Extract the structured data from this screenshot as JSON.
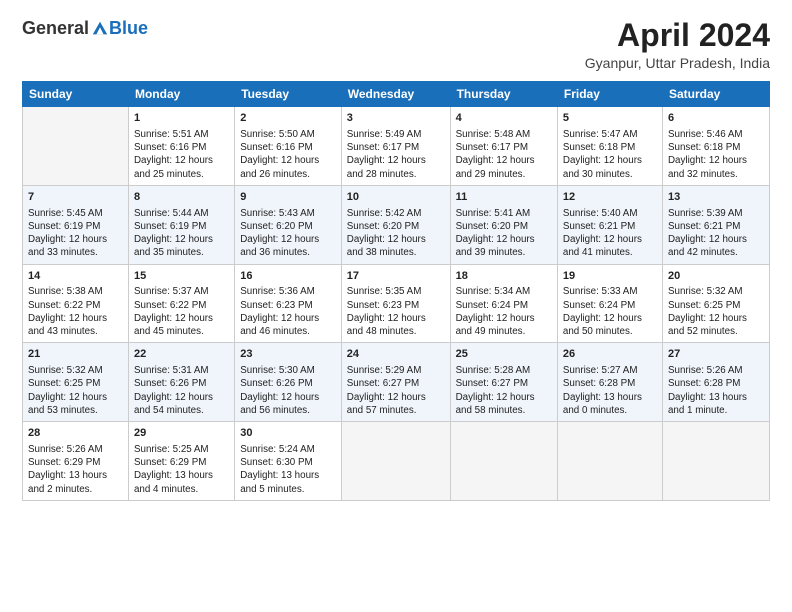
{
  "header": {
    "logo_general": "General",
    "logo_blue": "Blue",
    "title": "April 2024",
    "subtitle": "Gyanpur, Uttar Pradesh, India"
  },
  "days_of_week": [
    "Sunday",
    "Monday",
    "Tuesday",
    "Wednesday",
    "Thursday",
    "Friday",
    "Saturday"
  ],
  "weeks": [
    [
      {
        "day": "",
        "sunrise": "",
        "sunset": "",
        "daylight": "",
        "empty": true
      },
      {
        "day": "1",
        "sunrise": "Sunrise: 5:51 AM",
        "sunset": "Sunset: 6:16 PM",
        "daylight": "Daylight: 12 hours and 25 minutes."
      },
      {
        "day": "2",
        "sunrise": "Sunrise: 5:50 AM",
        "sunset": "Sunset: 6:16 PM",
        "daylight": "Daylight: 12 hours and 26 minutes."
      },
      {
        "day": "3",
        "sunrise": "Sunrise: 5:49 AM",
        "sunset": "Sunset: 6:17 PM",
        "daylight": "Daylight: 12 hours and 28 minutes."
      },
      {
        "day": "4",
        "sunrise": "Sunrise: 5:48 AM",
        "sunset": "Sunset: 6:17 PM",
        "daylight": "Daylight: 12 hours and 29 minutes."
      },
      {
        "day": "5",
        "sunrise": "Sunrise: 5:47 AM",
        "sunset": "Sunset: 6:18 PM",
        "daylight": "Daylight: 12 hours and 30 minutes."
      },
      {
        "day": "6",
        "sunrise": "Sunrise: 5:46 AM",
        "sunset": "Sunset: 6:18 PM",
        "daylight": "Daylight: 12 hours and 32 minutes."
      }
    ],
    [
      {
        "day": "7",
        "sunrise": "Sunrise: 5:45 AM",
        "sunset": "Sunset: 6:19 PM",
        "daylight": "Daylight: 12 hours and 33 minutes."
      },
      {
        "day": "8",
        "sunrise": "Sunrise: 5:44 AM",
        "sunset": "Sunset: 6:19 PM",
        "daylight": "Daylight: 12 hours and 35 minutes."
      },
      {
        "day": "9",
        "sunrise": "Sunrise: 5:43 AM",
        "sunset": "Sunset: 6:20 PM",
        "daylight": "Daylight: 12 hours and 36 minutes."
      },
      {
        "day": "10",
        "sunrise": "Sunrise: 5:42 AM",
        "sunset": "Sunset: 6:20 PM",
        "daylight": "Daylight: 12 hours and 38 minutes."
      },
      {
        "day": "11",
        "sunrise": "Sunrise: 5:41 AM",
        "sunset": "Sunset: 6:20 PM",
        "daylight": "Daylight: 12 hours and 39 minutes."
      },
      {
        "day": "12",
        "sunrise": "Sunrise: 5:40 AM",
        "sunset": "Sunset: 6:21 PM",
        "daylight": "Daylight: 12 hours and 41 minutes."
      },
      {
        "day": "13",
        "sunrise": "Sunrise: 5:39 AM",
        "sunset": "Sunset: 6:21 PM",
        "daylight": "Daylight: 12 hours and 42 minutes."
      }
    ],
    [
      {
        "day": "14",
        "sunrise": "Sunrise: 5:38 AM",
        "sunset": "Sunset: 6:22 PM",
        "daylight": "Daylight: 12 hours and 43 minutes."
      },
      {
        "day": "15",
        "sunrise": "Sunrise: 5:37 AM",
        "sunset": "Sunset: 6:22 PM",
        "daylight": "Daylight: 12 hours and 45 minutes."
      },
      {
        "day": "16",
        "sunrise": "Sunrise: 5:36 AM",
        "sunset": "Sunset: 6:23 PM",
        "daylight": "Daylight: 12 hours and 46 minutes."
      },
      {
        "day": "17",
        "sunrise": "Sunrise: 5:35 AM",
        "sunset": "Sunset: 6:23 PM",
        "daylight": "Daylight: 12 hours and 48 minutes."
      },
      {
        "day": "18",
        "sunrise": "Sunrise: 5:34 AM",
        "sunset": "Sunset: 6:24 PM",
        "daylight": "Daylight: 12 hours and 49 minutes."
      },
      {
        "day": "19",
        "sunrise": "Sunrise: 5:33 AM",
        "sunset": "Sunset: 6:24 PM",
        "daylight": "Daylight: 12 hours and 50 minutes."
      },
      {
        "day": "20",
        "sunrise": "Sunrise: 5:32 AM",
        "sunset": "Sunset: 6:25 PM",
        "daylight": "Daylight: 12 hours and 52 minutes."
      }
    ],
    [
      {
        "day": "21",
        "sunrise": "Sunrise: 5:32 AM",
        "sunset": "Sunset: 6:25 PM",
        "daylight": "Daylight: 12 hours and 53 minutes."
      },
      {
        "day": "22",
        "sunrise": "Sunrise: 5:31 AM",
        "sunset": "Sunset: 6:26 PM",
        "daylight": "Daylight: 12 hours and 54 minutes."
      },
      {
        "day": "23",
        "sunrise": "Sunrise: 5:30 AM",
        "sunset": "Sunset: 6:26 PM",
        "daylight": "Daylight: 12 hours and 56 minutes."
      },
      {
        "day": "24",
        "sunrise": "Sunrise: 5:29 AM",
        "sunset": "Sunset: 6:27 PM",
        "daylight": "Daylight: 12 hours and 57 minutes."
      },
      {
        "day": "25",
        "sunrise": "Sunrise: 5:28 AM",
        "sunset": "Sunset: 6:27 PM",
        "daylight": "Daylight: 12 hours and 58 minutes."
      },
      {
        "day": "26",
        "sunrise": "Sunrise: 5:27 AM",
        "sunset": "Sunset: 6:28 PM",
        "daylight": "Daylight: 13 hours and 0 minutes."
      },
      {
        "day": "27",
        "sunrise": "Sunrise: 5:26 AM",
        "sunset": "Sunset: 6:28 PM",
        "daylight": "Daylight: 13 hours and 1 minute."
      }
    ],
    [
      {
        "day": "28",
        "sunrise": "Sunrise: 5:26 AM",
        "sunset": "Sunset: 6:29 PM",
        "daylight": "Daylight: 13 hours and 2 minutes."
      },
      {
        "day": "29",
        "sunrise": "Sunrise: 5:25 AM",
        "sunset": "Sunset: 6:29 PM",
        "daylight": "Daylight: 13 hours and 4 minutes."
      },
      {
        "day": "30",
        "sunrise": "Sunrise: 5:24 AM",
        "sunset": "Sunset: 6:30 PM",
        "daylight": "Daylight: 13 hours and 5 minutes."
      },
      {
        "day": "",
        "sunrise": "",
        "sunset": "",
        "daylight": "",
        "empty": true
      },
      {
        "day": "",
        "sunrise": "",
        "sunset": "",
        "daylight": "",
        "empty": true
      },
      {
        "day": "",
        "sunrise": "",
        "sunset": "",
        "daylight": "",
        "empty": true
      },
      {
        "day": "",
        "sunrise": "",
        "sunset": "",
        "daylight": "",
        "empty": true
      }
    ]
  ]
}
